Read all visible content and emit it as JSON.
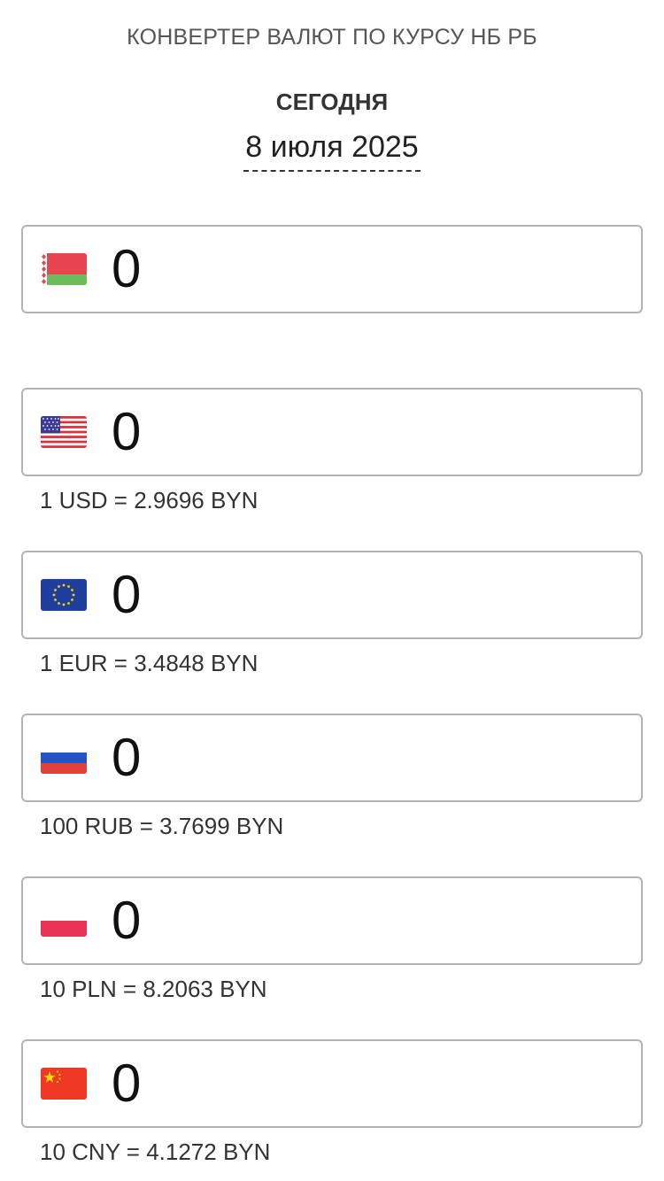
{
  "header": {
    "app_title": "КОНВЕРТЕР ВАЛЮТ ПО КУРСУ НБ РБ",
    "date_label": "СЕГОДНЯ",
    "date_value": "8 июля 2025"
  },
  "currencies": [
    {
      "code": "BYN",
      "flag_icon": "belarus-flag-icon",
      "amount": "0",
      "rate_text": ""
    },
    {
      "code": "USD",
      "flag_icon": "usa-flag-icon",
      "amount": "0",
      "rate_text": "1 USD = 2.9696 BYN"
    },
    {
      "code": "EUR",
      "flag_icon": "eu-flag-icon",
      "amount": "0",
      "rate_text": "1 EUR = 3.4848 BYN"
    },
    {
      "code": "RUB",
      "flag_icon": "russia-flag-icon",
      "amount": "0",
      "rate_text": "100 RUB = 3.7699 BYN"
    },
    {
      "code": "PLN",
      "flag_icon": "poland-flag-icon",
      "amount": "0",
      "rate_text": "10 PLN = 8.2063 BYN"
    },
    {
      "code": "CNY",
      "flag_icon": "china-flag-icon",
      "amount": "0",
      "rate_text": "10 CNY = 4.1272 BYN"
    }
  ],
  "colors": {
    "field_border": "#b3b3b3",
    "text": "#333333",
    "belarus_red": "#e8454f",
    "belarus_green": "#6cbc5c",
    "eu_blue": "#1f3f9e",
    "eu_stars": "#ffd200",
    "russia_blue": "#2353c4",
    "russia_red": "#e2403a",
    "poland_red": "#e83555",
    "china_red": "#ee3a24",
    "china_star": "#ffde00"
  }
}
